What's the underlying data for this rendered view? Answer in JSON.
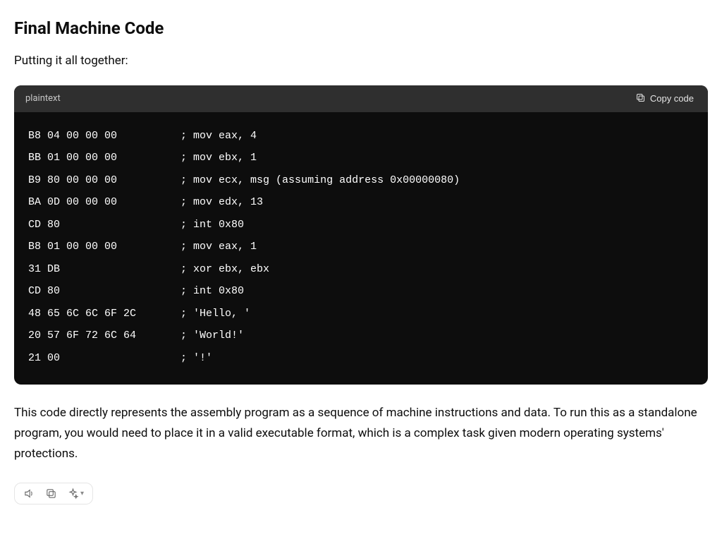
{
  "heading": "Final Machine Code",
  "intro": "Putting it all together:",
  "code_block": {
    "language_label": "plaintext",
    "copy_label": "Copy code",
    "lines": [
      {
        "hex": "B8 04 00 00 00",
        "comment": "; mov eax, 4"
      },
      {
        "hex": "BB 01 00 00 00",
        "comment": "; mov ebx, 1"
      },
      {
        "hex": "B9 80 00 00 00",
        "comment": "; mov ecx, msg (assuming address 0x00000080)"
      },
      {
        "hex": "BA 0D 00 00 00",
        "comment": "; mov edx, 13"
      },
      {
        "hex": "CD 80",
        "comment": "; int 0x80"
      },
      {
        "hex": "B8 01 00 00 00",
        "comment": "; mov eax, 1"
      },
      {
        "hex": "31 DB",
        "comment": "; xor ebx, ebx"
      },
      {
        "hex": "CD 80",
        "comment": "; int 0x80"
      },
      {
        "hex": "48 65 6C 6C 6F 2C",
        "comment": "; 'Hello, '"
      },
      {
        "hex": "20 57 6F 72 6C 64",
        "comment": "; 'World!'"
      },
      {
        "hex": "21 00",
        "comment": "; '!'"
      }
    ],
    "hex_col_width": 24
  },
  "outro": "This code directly represents the assembly program as a sequence of machine instructions and data. To run this as a standalone program, you would need to place it in a valid executable format, which is a complex task given modern operating systems' protections.",
  "actions": {
    "speak": "Read aloud",
    "copy": "Copy",
    "regenerate": "Regenerate"
  }
}
